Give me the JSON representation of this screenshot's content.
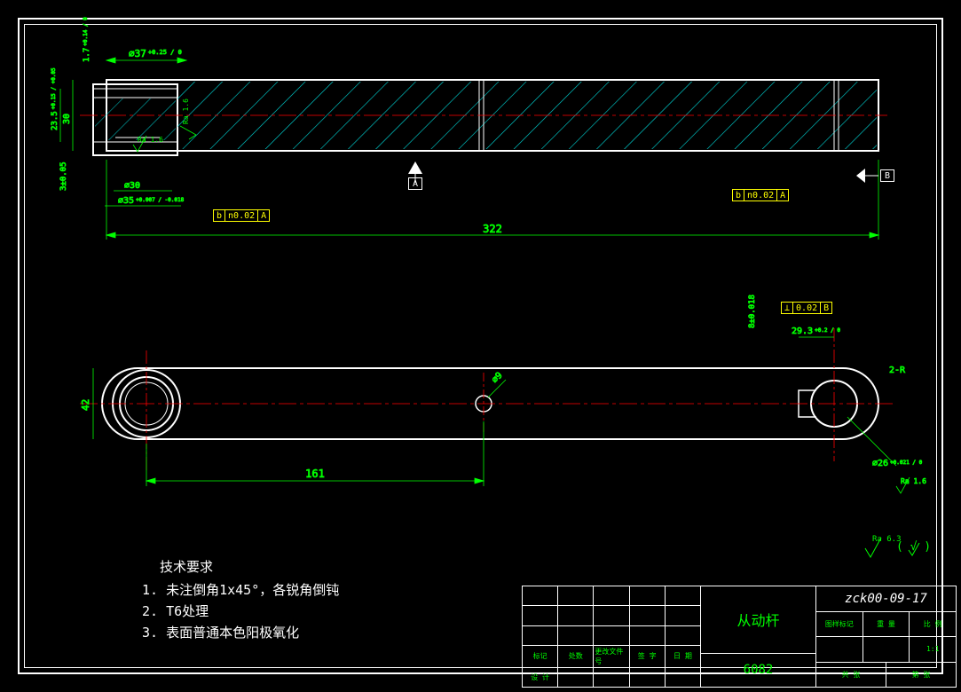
{
  "dimensions": {
    "d37": "⌀37",
    "d37_tol": "+0.25 / 0",
    "d30_small": "⌀30",
    "d35": "⌀35",
    "d35_tol": "+0.007 / -0.018",
    "d30_height": "30",
    "d23_5": "23.5",
    "d23_5_tol": "+0.15 / +0.05",
    "d1_7": "1.7",
    "d1_7_tol": "+0.14 / 0",
    "d3_005": "3±0.05",
    "d322": "322",
    "d161": "161",
    "d42": "42",
    "d9": "⌀9",
    "d29_3": "29.3",
    "d29_3_tol": "+0.2 / 0",
    "d26": "⌀26",
    "d26_tol": "+0.021 / 0",
    "d8_018": "8±0.018",
    "d2R": "2-R"
  },
  "surface": {
    "ra16_1": "Ra 1.6",
    "ra16_2": "Ra 1.6",
    "ra16_3": "Ra 1.6",
    "ra63": "Ra 6.3",
    "rest": "( √ )"
  },
  "gtol": {
    "g1": [
      "b",
      "n0.02",
      "A"
    ],
    "g2": [
      "b",
      "n0.02",
      "A"
    ],
    "g3": [
      "⊥",
      "0.02",
      "B"
    ]
  },
  "datum": {
    "A": "A",
    "B": "B"
  },
  "tech_req": {
    "title": "技术要求",
    "line1": "1. 未注倒角1x45°，各锐角倒钝",
    "line2": "2. T6处理",
    "line3": "3. 表面普通本色阳极氧化"
  },
  "title_block": {
    "part_name": "从动杆",
    "material": "6082",
    "dwg_no": "zck00-09-17",
    "headers": [
      "标记",
      "处数",
      "更改文件号",
      "签 字",
      "日 期"
    ],
    "row2": [
      "设 计",
      "",
      "",
      "",
      ""
    ],
    "sub_headers": [
      "图样标记",
      "重 量",
      "比 例"
    ],
    "scale": "1:1",
    "bottom": [
      "共    张",
      "第    张"
    ]
  }
}
